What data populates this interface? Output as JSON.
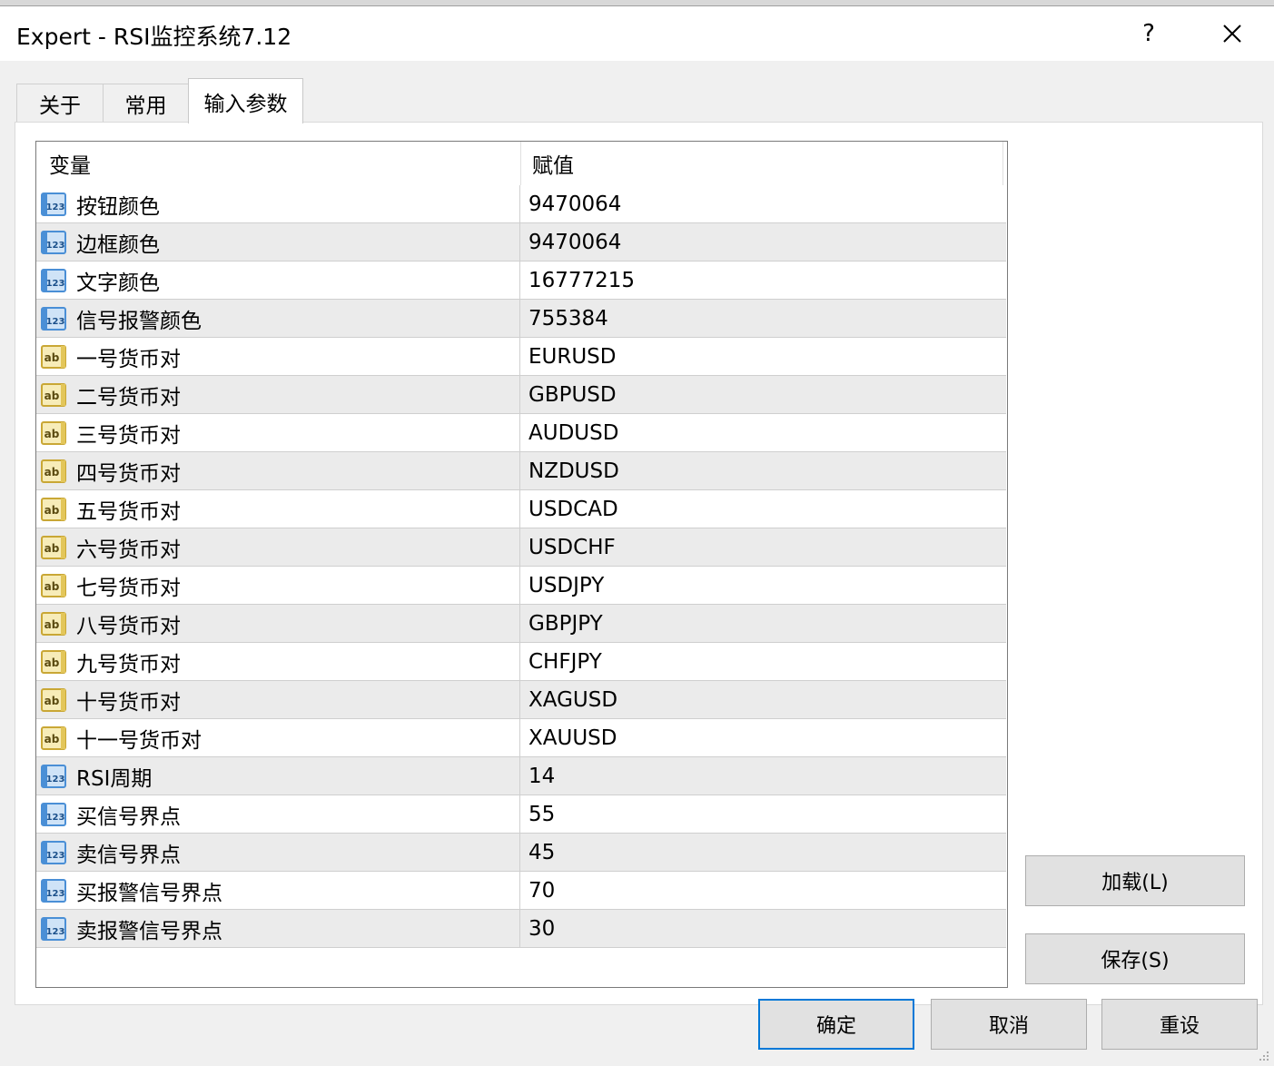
{
  "window": {
    "title": "Expert - RSI监控系统7.12",
    "help_label": "?"
  },
  "tabs": [
    {
      "label": "关于"
    },
    {
      "label": "常用"
    },
    {
      "label": "输入参数"
    }
  ],
  "table": {
    "columns": [
      "变量",
      "赋值"
    ],
    "rows": [
      {
        "type": "int",
        "name": "按钮颜色",
        "value": "9470064"
      },
      {
        "type": "int",
        "name": "边框颜色",
        "value": "9470064"
      },
      {
        "type": "int",
        "name": "文字颜色",
        "value": "16777215"
      },
      {
        "type": "int",
        "name": "信号报警颜色",
        "value": "755384"
      },
      {
        "type": "string",
        "name": "一号货币对",
        "value": "EURUSD"
      },
      {
        "type": "string",
        "name": "二号货币对",
        "value": "GBPUSD"
      },
      {
        "type": "string",
        "name": "三号货币对",
        "value": "AUDUSD"
      },
      {
        "type": "string",
        "name": "四号货币对",
        "value": "NZDUSD"
      },
      {
        "type": "string",
        "name": "五号货币对",
        "value": "USDCAD"
      },
      {
        "type": "string",
        "name": "六号货币对",
        "value": "USDCHF"
      },
      {
        "type": "string",
        "name": "七号货币对",
        "value": "USDJPY"
      },
      {
        "type": "string",
        "name": "八号货币对",
        "value": "GBPJPY"
      },
      {
        "type": "string",
        "name": "九号货币对",
        "value": "CHFJPY"
      },
      {
        "type": "string",
        "name": "十号货币对",
        "value": "XAGUSD"
      },
      {
        "type": "string",
        "name": "十一号货币对",
        "value": "XAUUSD"
      },
      {
        "type": "int",
        "name": "RSI周期",
        "value": "14"
      },
      {
        "type": "int",
        "name": "买信号界点",
        "value": "55"
      },
      {
        "type": "int",
        "name": "卖信号界点",
        "value": "45"
      },
      {
        "type": "int",
        "name": "买报警信号界点",
        "value": "70"
      },
      {
        "type": "int",
        "name": "卖报警信号界点",
        "value": "30"
      }
    ]
  },
  "side_buttons": {
    "load": "加载(L)",
    "save": "保存(S)"
  },
  "footer_buttons": {
    "ok": "确定",
    "cancel": "取消",
    "reset": "重设"
  },
  "icons": {
    "int": "numeric-123-icon",
    "string": "text-ab-icon",
    "close": "close-icon"
  },
  "colors": {
    "accent": "#0078d7",
    "row_alt": "#ebebeb",
    "int_icon": "#4a8fd6",
    "string_icon": "#e3c65a"
  }
}
